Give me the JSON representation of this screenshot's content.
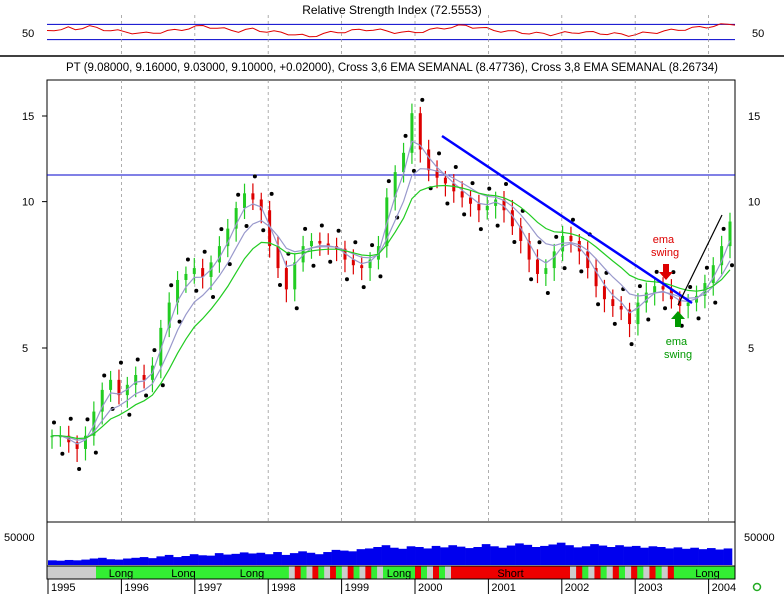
{
  "colors": {
    "rsi_line": "#e00000",
    "hline": "#0000cc",
    "trend": "#0000ff",
    "ema_fast": "#22cc22",
    "ema_slow": "#9999cc",
    "up_bar": "#22cc22",
    "down_bar": "#dd0000",
    "volume": "#0000ee",
    "long_band": "#33ee33",
    "short_band": "#ee0000",
    "neutral_band": "#cccccc",
    "grid": "#999999",
    "arrow_sell": "#dd0000",
    "arrow_buy": "#009900"
  },
  "chart_data": [
    {
      "type": "line",
      "panel": "rsi",
      "title": "Relative Strength Index (72.5553)",
      "ytick_labels": [
        "50"
      ],
      "grid": true,
      "series": [
        {
          "values": [
            54,
            57,
            55,
            60,
            58,
            62,
            64,
            60,
            57,
            55,
            52,
            50,
            49,
            47,
            46,
            48,
            50,
            52,
            54,
            57,
            60,
            63,
            66,
            64,
            60,
            57,
            55,
            53,
            55,
            57,
            54,
            52,
            50,
            48,
            46,
            43,
            40,
            38,
            42,
            45,
            48,
            50,
            51,
            53,
            55,
            57,
            56,
            54,
            52,
            50,
            49,
            48,
            50,
            52,
            55,
            58,
            61,
            63,
            65,
            67,
            64,
            61,
            58,
            55,
            53,
            51,
            50,
            49,
            47,
            46,
            45,
            44,
            46,
            47,
            48,
            50,
            49,
            48,
            47,
            46,
            45,
            43,
            42,
            44,
            46,
            48,
            50,
            52,
            54,
            56,
            58,
            60,
            62,
            64,
            66,
            68,
            70,
            72
          ]
        }
      ]
    },
    {
      "type": "candlestick",
      "panel": "price",
      "title": "PT (9.08000, 9.16000, 9.03000, 9.10000, +0.02000), Cross 3,6 EMA SEMANAL (8.47736), Cross 3,8 EMA SEMANAL (8.26734)",
      "ytick_labels": [
        "5",
        "10",
        "15"
      ],
      "scale": "log",
      "grid": true,
      "x_labels": [
        "1995",
        "1996",
        "1997",
        "1998",
        "1999",
        "2000",
        "2001",
        "2002",
        "2003",
        "2004"
      ],
      "series": [
        {
          "name": "PT close",
          "values": [
            3.3,
            3.3,
            3.2,
            3.1,
            3.3,
            3.7,
            4.1,
            4.3,
            4.0,
            4.2,
            4.4,
            4.3,
            4.6,
            5.5,
            6.2,
            6.9,
            7.1,
            7.3,
            7.0,
            7.5,
            8.1,
            8.8,
            9.7,
            10.4,
            10.1,
            9.6,
            8.1,
            7.3,
            6.6,
            7.5,
            8.1,
            8.3,
            8.2,
            8.1,
            8.0,
            7.6,
            7.4,
            7.3,
            7.6,
            8.1,
            10.2,
            11.5,
            12.6,
            15.2,
            12.8,
            11.6,
            11.2,
            10.9,
            10.5,
            10.2,
            9.9,
            9.6,
            9.8,
            10.1,
            9.6,
            8.9,
            8.3,
            7.6,
            7.1,
            7.3,
            7.9,
            8.5,
            8.3,
            7.9,
            7.3,
            6.7,
            6.3,
            6.1,
            6.0,
            5.6,
            6.2,
            6.5,
            6.7,
            6.6,
            6.3,
            6.1,
            6.2,
            6.4,
            6.8,
            7.4,
            8.1,
            9.1
          ]
        }
      ],
      "annotations": [
        "ema\nswing",
        "ema\nswing"
      ]
    },
    {
      "type": "bar",
      "panel": "volume",
      "ytick_labels": [
        "50000"
      ],
      "series": [
        {
          "values": [
            0.13,
            0.12,
            0.14,
            0.13,
            0.15,
            0.18,
            0.2,
            0.16,
            0.15,
            0.18,
            0.2,
            0.22,
            0.19,
            0.24,
            0.28,
            0.22,
            0.25,
            0.3,
            0.27,
            0.26,
            0.33,
            0.29,
            0.31,
            0.35,
            0.32,
            0.34,
            0.3,
            0.36,
            0.28,
            0.33,
            0.38,
            0.34,
            0.3,
            0.36,
            0.42,
            0.4,
            0.38,
            0.44,
            0.46,
            0.5,
            0.55,
            0.48,
            0.45,
            0.52,
            0.5,
            0.46,
            0.53,
            0.49,
            0.55,
            0.51,
            0.47,
            0.5,
            0.58,
            0.52,
            0.48,
            0.54,
            0.6,
            0.56,
            0.5,
            0.53,
            0.57,
            0.62,
            0.55,
            0.49,
            0.52,
            0.58,
            0.54,
            0.5,
            0.55,
            0.51,
            0.53,
            0.48,
            0.52,
            0.5,
            0.46,
            0.49,
            0.45,
            0.48,
            0.44,
            0.47,
            0.43,
            0.46
          ]
        }
      ]
    },
    {
      "type": "table",
      "panel": "signals",
      "segments": [
        {
          "state": "neutral"
        },
        {
          "state": "long",
          "label": "Long"
        },
        {
          "state": "long",
          "label": "Long"
        },
        {
          "state": "long",
          "label": "Long"
        },
        {
          "state": "mixed"
        },
        {
          "state": "long",
          "label": "Long"
        },
        {
          "state": "mixed"
        },
        {
          "state": "short",
          "label": "Short"
        },
        {
          "state": "mixed"
        },
        {
          "state": "long",
          "label": "Long"
        }
      ]
    }
  ]
}
